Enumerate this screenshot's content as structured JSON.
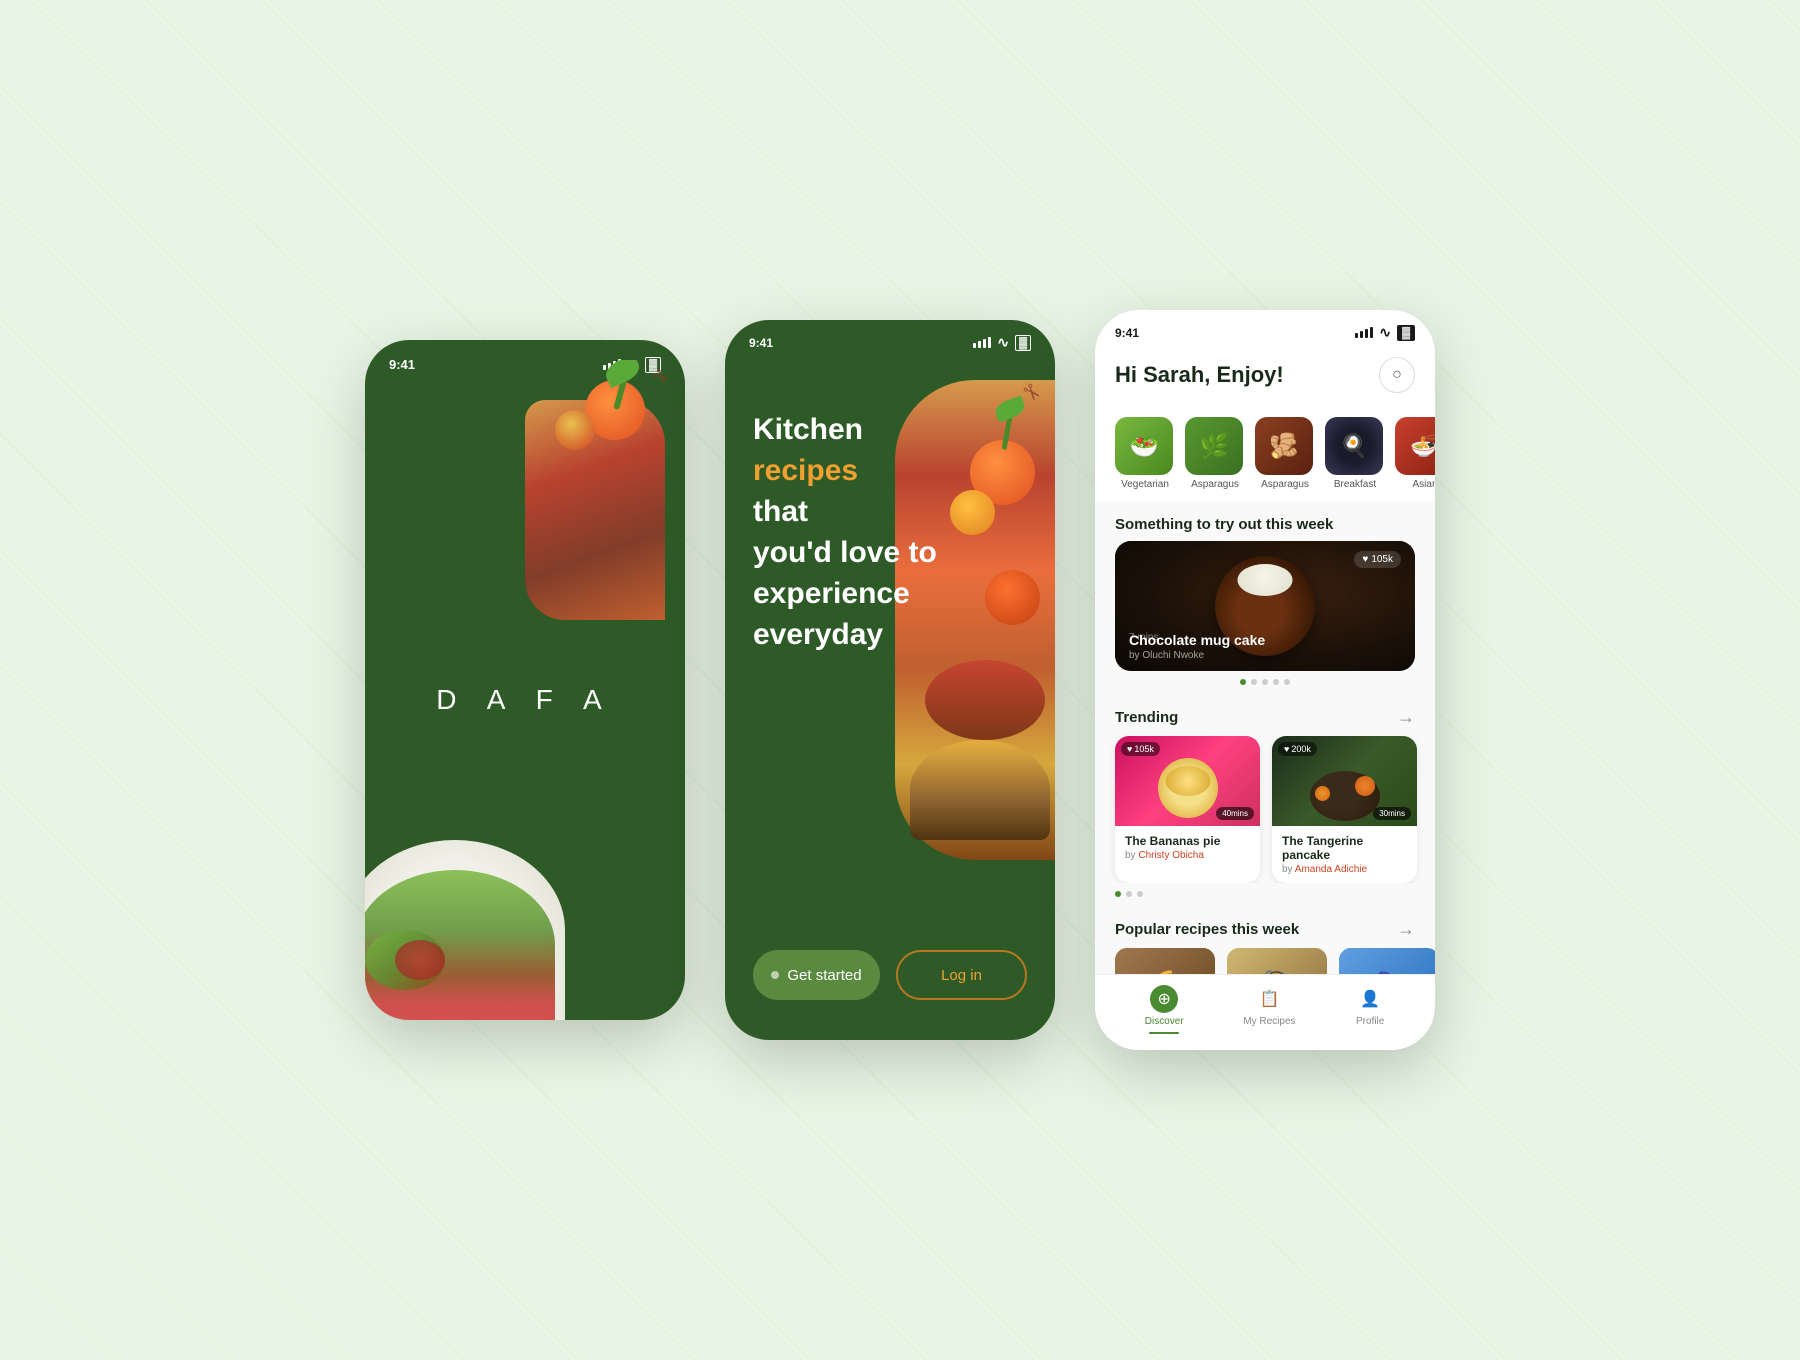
{
  "screen1": {
    "status_time": "9:41",
    "logo": "D A F A"
  },
  "screen2": {
    "status_time": "9:41",
    "hero_line1": "Kitchen",
    "hero_line2": "recipes",
    "hero_line3": "that",
    "hero_line4": "you'd love to",
    "hero_line5": "experience",
    "hero_line6": "everyday",
    "btn_get_started": "Get started",
    "btn_login": "Log in"
  },
  "screen3": {
    "status_time": "9:41",
    "greeting": "Hi Sarah, Enjoy!",
    "categories": [
      {
        "label": "Vegetarian",
        "type": "vegetarian"
      },
      {
        "label": "Asparagus",
        "type": "asparagus"
      },
      {
        "label": "Asparagus",
        "type": "asparagus2"
      },
      {
        "label": "Breakfast",
        "type": "breakfast"
      },
      {
        "label": "Asian",
        "type": "asian"
      }
    ],
    "featured_section": "Something to try out this week",
    "featured_card": {
      "title": "Chocolate mug cake",
      "author": "Oluchi Nwoke",
      "likes": "105k",
      "time": "7 mins"
    },
    "trending_section": "Trending",
    "trending": [
      {
        "title": "The Bananas pie",
        "author": "Christy Obicha",
        "likes": "105k",
        "time": "40mins",
        "type": "banana"
      },
      {
        "title": "The Tangerine pancake",
        "author": "Amanda Adichie",
        "likes": "200k",
        "time": "30mins",
        "type": "tangerine"
      }
    ],
    "popular_section": "Popular recipes this week",
    "nav": {
      "discover": "Discover",
      "my_recipes": "My Recipes",
      "profile": "Profile"
    }
  }
}
